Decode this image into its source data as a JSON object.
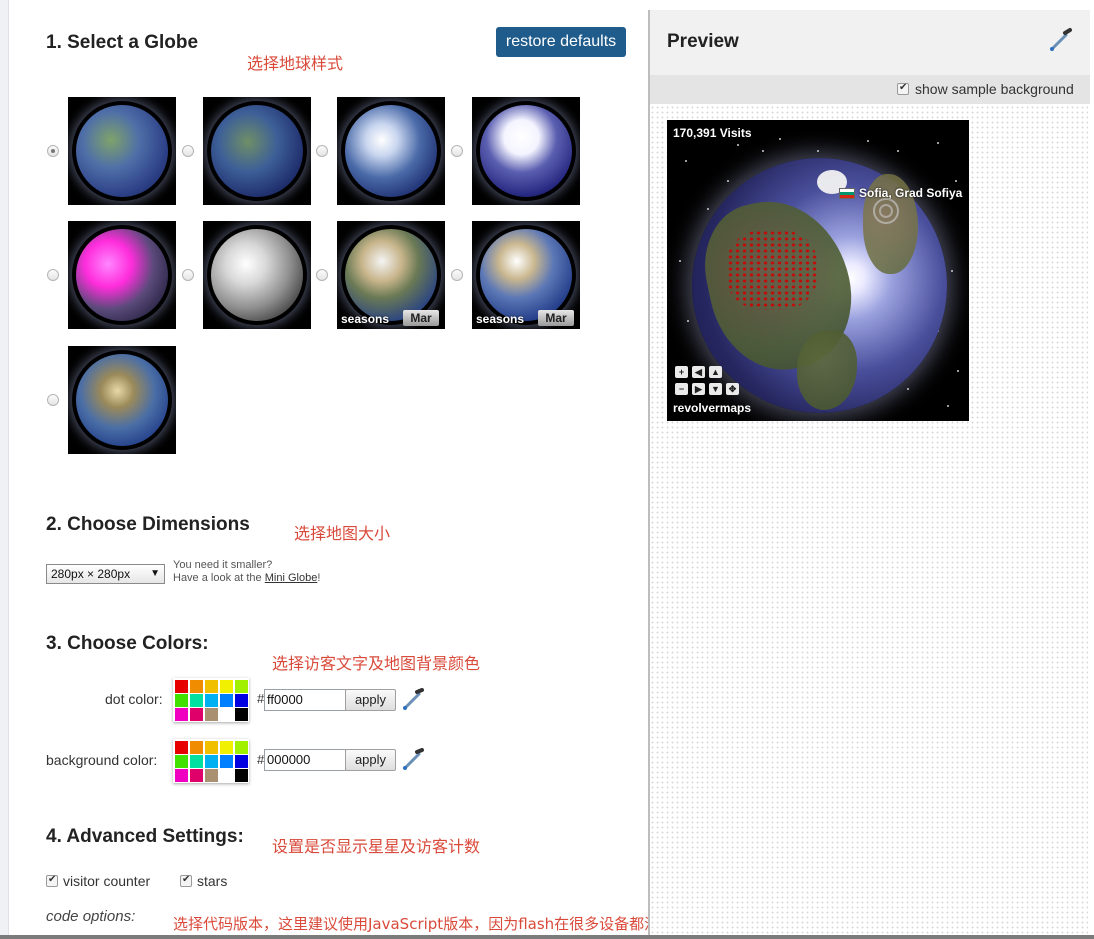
{
  "sections": {
    "globe": {
      "title": "1. Select a Globe",
      "annotation": "选择地球样式",
      "restore_label": "restore defaults",
      "options": [
        {
          "style": "classic",
          "selected": true
        },
        {
          "style": "classic-dark",
          "selected": false
        },
        {
          "style": "clouds",
          "selected": false
        },
        {
          "style": "white-continents",
          "selected": false
        },
        {
          "style": "magenta",
          "selected": false
        },
        {
          "style": "silver",
          "selected": false
        },
        {
          "style": "seasons",
          "selected": false,
          "season_text": "seasons",
          "month": "Mar"
        },
        {
          "style": "seasons-blue",
          "selected": false,
          "season_text": "seasons",
          "month": "Mar"
        },
        {
          "style": "europe-africa",
          "selected": false
        }
      ]
    },
    "dimensions": {
      "title": "2. Choose Dimensions",
      "annotation": "选择地图大小",
      "selected": "280px × 280px",
      "hint_line1": "You need it smaller?",
      "hint_line2_pre": "Have a look at the ",
      "hint_link": "Mini Globe",
      "hint_line2_post": "!"
    },
    "colors": {
      "title": "3. Choose Colors:",
      "annotation": "选择访客文字及地图背景颜色",
      "dot": {
        "label": "dot color:",
        "hash": "#",
        "value": "ff0000",
        "apply": "apply"
      },
      "background": {
        "label": "background color:",
        "hash": "#",
        "value": "000000",
        "apply": "apply"
      },
      "palette": [
        "#e60000",
        "#f08c00",
        "#f0c000",
        "#f0f000",
        "#a0f000",
        "#40e000",
        "#00e0a0",
        "#00b0f0",
        "#0080ff",
        "#0000e0",
        "#f000c0",
        "#e0006a",
        "#a89070",
        "#ffffff",
        "#000000"
      ]
    },
    "advanced": {
      "title": "4. Advanced Settings:",
      "annotation": "设置是否显示星星及访客计数",
      "visitor_counter": {
        "label": "visitor counter",
        "checked": true
      },
      "stars": {
        "label": "stars",
        "checked": true
      },
      "code_options": "code options:",
      "code_annotation": "选择代码版本，这里建议使用JavaScript版本，因为flash在很多设备都没法用了"
    }
  },
  "preview": {
    "title": "Preview",
    "show_sample_bg": {
      "label": "show sample background",
      "checked": true
    },
    "globe": {
      "visits": "170,391 Visits",
      "city": "Sofia, Grad Sofiya",
      "brand": "revolvermaps"
    }
  },
  "icons": {
    "picker": "eyedropper-icon",
    "controls": [
      "zoom-in-icon",
      "left-arrow-icon",
      "up-arrow-icon",
      "zoom-out-icon",
      "right-arrow-icon",
      "down-arrow-icon",
      "move-icon"
    ]
  }
}
